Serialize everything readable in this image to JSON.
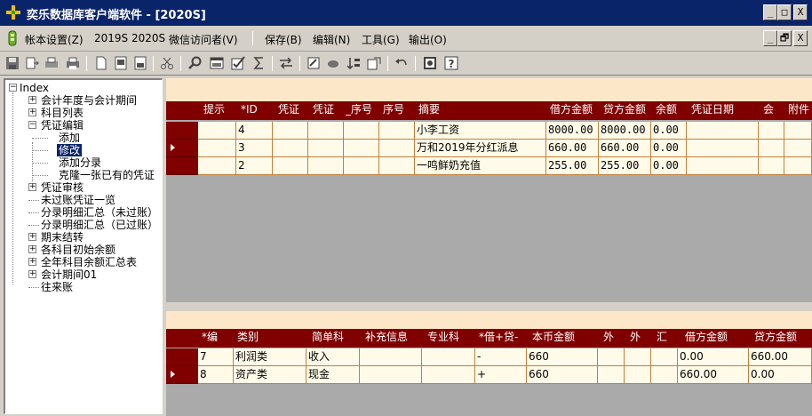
{
  "window": {
    "title": "奕乐数据库客户端软件 - [2020S]",
    "controls": [
      "_",
      "□",
      "X"
    ],
    "child_controls": [
      "_",
      "🗗",
      "X"
    ]
  },
  "menubar": {
    "items": [
      {
        "label": "帐本设置(Z)"
      },
      {
        "label": "2019S"
      },
      {
        "label": "2020S"
      },
      {
        "label": "微信访问者(V)"
      },
      {
        "label": "保存(B)"
      },
      {
        "label": "编辑(N)"
      },
      {
        "label": "工具(G)"
      },
      {
        "label": "输出(O)"
      }
    ]
  },
  "toolbar": {
    "icons": [
      "save-icon",
      "open-icon",
      "print-preview-icon",
      "print-icon",
      "new-page-icon",
      "form-icon",
      "report-icon",
      "cut-icon",
      "search-icon",
      "window-icon",
      "check-icon",
      "sum-icon",
      "transfer-icon",
      "edit-icon",
      "cloud-icon",
      "sort-icon",
      "export-icon",
      "undo-icon",
      "screen-icon",
      "help-icon"
    ]
  },
  "tree": {
    "root": "Index",
    "nodes": [
      {
        "label": "会计年度与会计期间",
        "level": 1,
        "expander": "+"
      },
      {
        "label": "科目列表",
        "level": 1,
        "expander": "+"
      },
      {
        "label": "凭证编辑",
        "level": 1,
        "expander": "-"
      },
      {
        "label": "添加",
        "level": 2
      },
      {
        "label": "修改",
        "level": 2,
        "selected": true
      },
      {
        "label": "添加分录",
        "level": 2
      },
      {
        "label": "克隆一张已有的凭证",
        "level": 2
      },
      {
        "label": "凭证审核",
        "level": 1,
        "expander": "+"
      },
      {
        "label": "未过账凭证一览",
        "level": 1
      },
      {
        "label": "分录明细汇总（未过账）",
        "level": 1
      },
      {
        "label": "分录明细汇总（已过账）",
        "level": 1
      },
      {
        "label": "期末结转",
        "level": 1,
        "expander": "+"
      },
      {
        "label": "各科目初始余额",
        "level": 1,
        "expander": "+"
      },
      {
        "label": "全年科目余额汇总表",
        "level": 1,
        "expander": "+"
      },
      {
        "label": "会计期间01",
        "level": 1,
        "expander": "+"
      },
      {
        "label": "往来账",
        "level": 1
      }
    ]
  },
  "voucher_grid": {
    "columns": [
      "提示",
      "*ID",
      "凭证",
      "凭证",
      "_序号",
      "序号",
      "摘要",
      "借方金额",
      "贷方金额",
      "余额",
      "凭证日期",
      "会",
      "附件"
    ],
    "rows": [
      [
        "",
        "4",
        "",
        "",
        "",
        "",
        "小李工资",
        "8000.00",
        "8000.00",
        "0.00",
        "",
        "",
        ""
      ],
      [
        "",
        "3",
        "",
        "",
        "",
        "",
        "万和2019年分红派息",
        "660.00",
        "660.00",
        "0.00",
        "",
        "",
        ""
      ],
      [
        "",
        "2",
        "",
        "",
        "",
        "",
        "一鸣鲜奶充值",
        "255.00",
        "255.00",
        "0.00",
        "",
        "",
        ""
      ]
    ],
    "current_row": 1
  },
  "entry_grid": {
    "columns": [
      "*编",
      "类别",
      "简单科",
      "补充信息",
      "专业科",
      "*借+贷-",
      "本币金额",
      "外",
      "外",
      "汇",
      "借方金额",
      "贷方金额"
    ],
    "rows": [
      [
        "7",
        "利润类",
        "收入",
        "",
        "",
        "-",
        "660",
        "",
        "",
        "",
        "0.00",
        "660.00"
      ],
      [
        "8",
        "资产类",
        "现金",
        "",
        "",
        "+",
        "660",
        "",
        "",
        "",
        "660.00",
        "0.00"
      ]
    ],
    "current_row": 1
  }
}
